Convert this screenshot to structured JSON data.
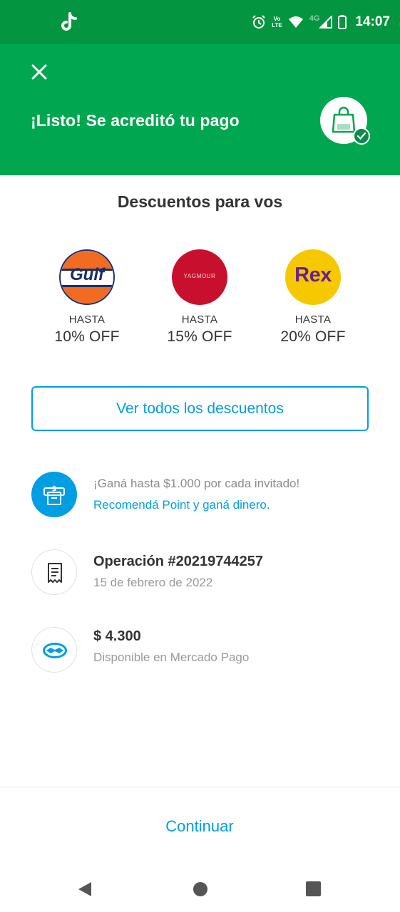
{
  "status_bar": {
    "time": "14:07",
    "volte_top": "Vo",
    "volte_bottom": "LTE",
    "network": "4G"
  },
  "header": {
    "title": "¡Listo! Se acreditó tu pago",
    "background_color": "#00a650"
  },
  "discounts": {
    "title": "Descuentos para vos",
    "items": [
      {
        "brand": "Gulf",
        "prefix": "HASTA",
        "amount": "10% OFF"
      },
      {
        "brand": "YAGMOUR",
        "prefix": "HASTA",
        "amount": "15% OFF"
      },
      {
        "brand": "Rex",
        "prefix": "HASTA",
        "amount": "20% OFF"
      }
    ],
    "see_all_label": "Ver todos los descuentos"
  },
  "referral": {
    "text": "¡Ganá hasta $1.000 por cada invitado!",
    "link": "Recomendá Point y ganá dinero."
  },
  "operation": {
    "title": "Operación #20219744257",
    "date": "15 de febrero de 2022"
  },
  "balance": {
    "amount": "$ 4.300",
    "caption": "Disponible en Mercado Pago"
  },
  "footer": {
    "continue_label": "Continuar"
  },
  "colors": {
    "accent": "#009ee3",
    "status_bar": "#03953f",
    "text": "#333333",
    "muted": "#999999"
  }
}
